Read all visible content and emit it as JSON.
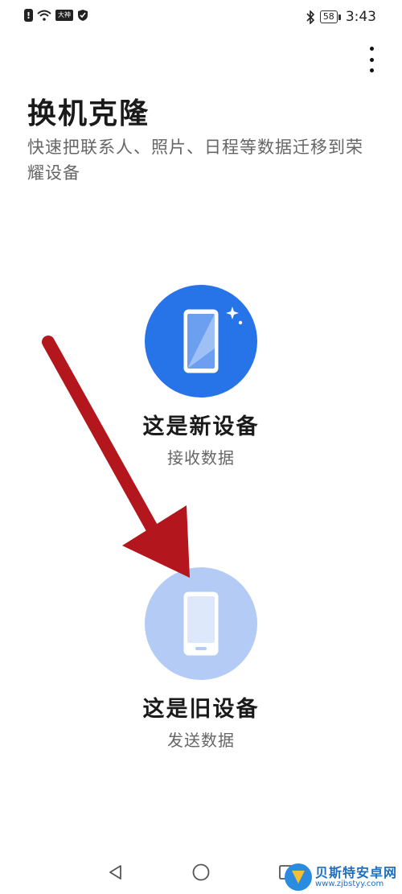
{
  "status_bar": {
    "badge_text": "大神",
    "battery_level": "58",
    "time": "3:43"
  },
  "header": {
    "title": "换机克隆",
    "subtitle": "快速把联系人、照片、日程等数据迁移到荣耀设备"
  },
  "options": {
    "new_device": {
      "label": "这是新设备",
      "sub": "接收数据"
    },
    "old_device": {
      "label": "这是旧设备",
      "sub": "发送数据"
    }
  },
  "watermark": {
    "title": "贝斯特安卓网",
    "url": "www.zjbstyy.com"
  },
  "colors": {
    "primary_blue": "#2773e8",
    "light_blue": "#b3cbf5",
    "arrow_red": "#b3161c"
  },
  "icons": [
    "alert-icon",
    "wifi-icon",
    "shield-icon",
    "bluetooth-icon",
    "more-vert-icon",
    "phone-sparkle-icon",
    "phone-icon",
    "back-icon",
    "home-icon",
    "recents-icon",
    "logo-icon"
  ]
}
